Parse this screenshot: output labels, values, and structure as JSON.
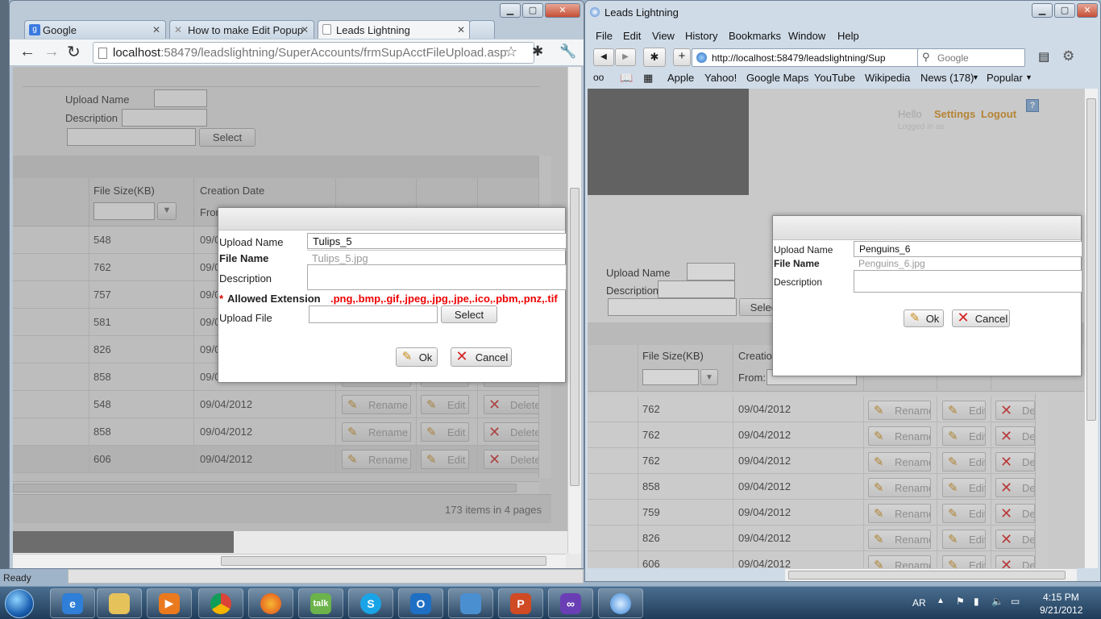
{
  "chrome": {
    "tabs": [
      {
        "label": "Google"
      },
      {
        "label": "How to make Edit Popup"
      },
      {
        "label": "Leads Lightning"
      }
    ],
    "url_host": "localhost",
    "url_rest": ":58479/leadslightning/SuperAccounts/frmSupAcctFileUpload.asp",
    "page": {
      "upload_name_label": "Upload Name",
      "description_label": "Description",
      "select_label": "Select",
      "col_file_size": "File Size(KB)",
      "col_creation_date": "Creation Date",
      "from_label": "From",
      "rows": [
        {
          "size": "548",
          "date": "09/0"
        },
        {
          "size": "762",
          "date": "09/0"
        },
        {
          "size": "757",
          "date": "09/0"
        },
        {
          "size": "581",
          "date": "09/0"
        },
        {
          "size": "826",
          "date": "09/0"
        },
        {
          "size": "858",
          "date": "09/0"
        },
        {
          "size": "548",
          "date": "09/04/2012"
        },
        {
          "size": "858",
          "date": "09/04/2012"
        },
        {
          "size": "606",
          "date": "09/04/2012"
        }
      ],
      "rename_label": "Rename",
      "edit_label": "Edit",
      "delete_label": "Delete",
      "pager_text": "173 items in 4 pages"
    },
    "modal": {
      "upload_name_label": "Upload Name",
      "upload_name_value": "Tulips_5",
      "file_name_label": "File Name",
      "file_name_value": "Tulips_5.jpg",
      "description_label": "Description",
      "allowed_label": "Allowed Extension",
      "allowed_star": "*",
      "allowed_value": ".png,.bmp,.gif,.jpeg,.jpg,.jpe,.ico,.pbm,.pnz,.tif",
      "upload_file_label": "Upload File",
      "select_label": "Select",
      "ok_label": "Ok",
      "cancel_label": "Cancel"
    }
  },
  "firefox": {
    "title": "Leads Lightning",
    "menu": [
      "File",
      "Edit",
      "View",
      "History",
      "Bookmarks",
      "Window",
      "Help"
    ],
    "url": "http://localhost:58479/leadslightning/Sup",
    "search_placeholder": "Google",
    "bookmarks": [
      "Apple",
      "Yahoo!",
      "Google Maps",
      "YouTube",
      "Wikipedia",
      "News (178)",
      "Popular"
    ],
    "page": {
      "hello_label": "Hello",
      "settings_label": "Settings",
      "logout_label": "Logout",
      "logged_in_label": "Logged in as",
      "upload_name_label": "Upload Name",
      "description_label": "Description",
      "select_partial": "Selec",
      "col_file_size": "File Size(KB)",
      "col_creation": "Creation",
      "from_label": "From:",
      "rows": [
        {
          "size": "762",
          "date": "09/04/2012"
        },
        {
          "size": "762",
          "date": "09/04/2012"
        },
        {
          "size": "762",
          "date": "09/04/2012"
        },
        {
          "size": "858",
          "date": "09/04/2012"
        },
        {
          "size": "759",
          "date": "09/04/2012"
        },
        {
          "size": "826",
          "date": "09/04/2012"
        },
        {
          "size": "606",
          "date": "09/04/2012"
        }
      ],
      "rename_label": "Rename",
      "edit_label": "Edit",
      "delete_partial": "Del"
    },
    "modal": {
      "upload_name_label": "Upload Name",
      "upload_name_value": "Penguins_6",
      "file_name_label": "File Name",
      "file_name_value": "Penguins_6.jpg",
      "description_label": "Description",
      "ok_label": "Ok",
      "cancel_label": "Cancel"
    }
  },
  "status_text": "Ready",
  "taskbar": {
    "skype_label": "talk",
    "lang": "AR",
    "time": "4:15 PM",
    "date": "9/21/2012"
  }
}
